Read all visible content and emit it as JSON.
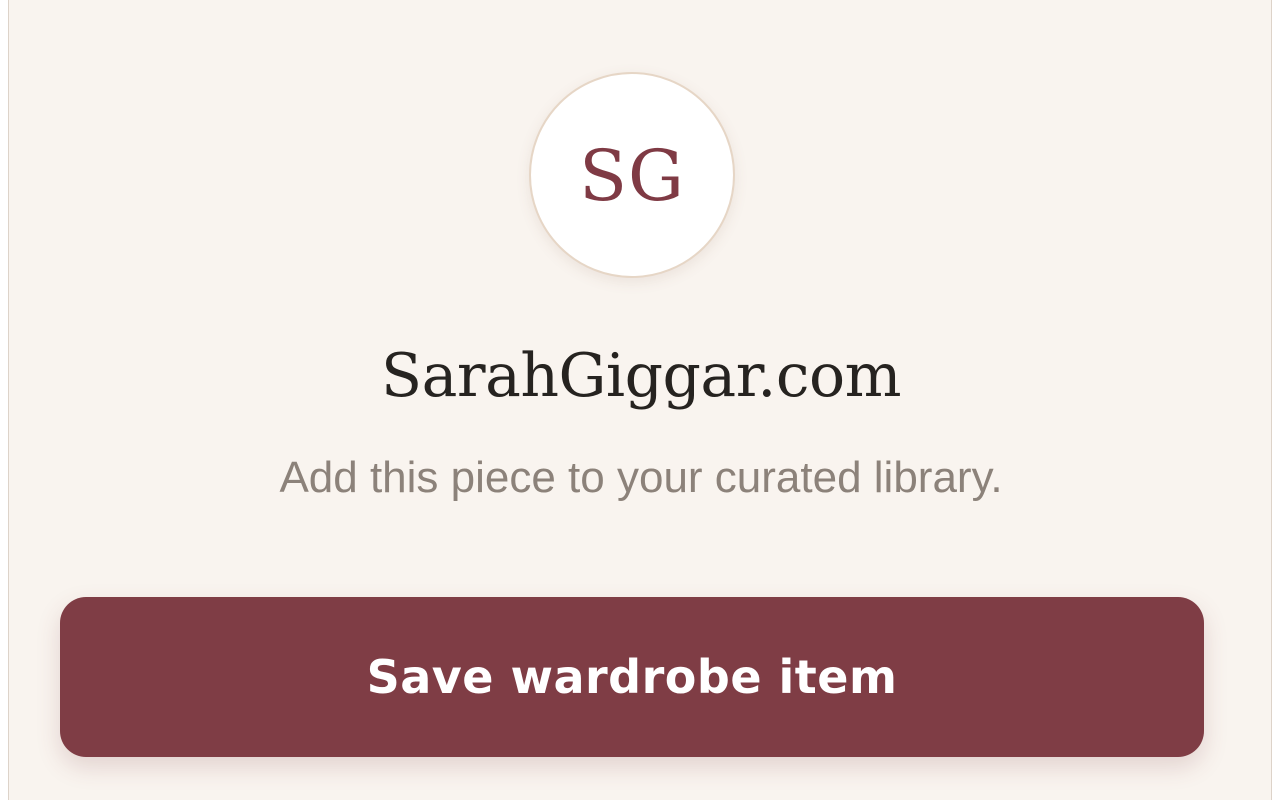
{
  "avatar": {
    "initials": "SG"
  },
  "site": {
    "name": "SarahGiggar.com",
    "subtitle": "Add this piece to your curated library."
  },
  "actions": {
    "save_label": "Save wardrobe item"
  },
  "colors": {
    "accent": "#7f3d45",
    "background": "#f9f4ef",
    "text_primary": "#262320",
    "text_secondary": "#8c827a"
  }
}
